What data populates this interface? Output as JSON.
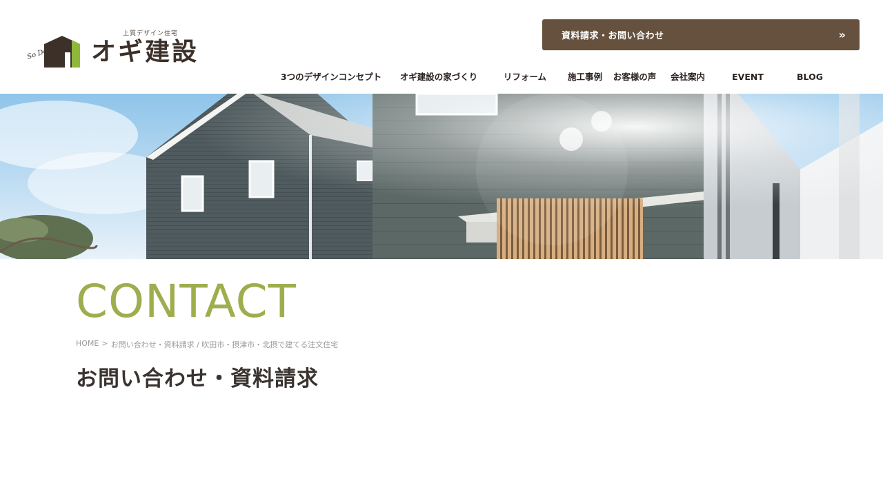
{
  "header": {
    "logo": {
      "tagline": "上質デザイン住宅",
      "name": "オギ建設",
      "script_text": "So Design!",
      "colors": {
        "brand_brown": "#3c3028",
        "brand_green": "#8fb83b"
      }
    },
    "cta": {
      "label": "資料請求・お問い合わせ",
      "icon": "double-chevron-right-icon"
    },
    "nav": [
      {
        "label": "3つのデザインコンセプト"
      },
      {
        "label": "オギ建設の家づくり"
      },
      {
        "label": "リフォーム"
      },
      {
        "label": "施工事例"
      },
      {
        "label": "お客様の声"
      },
      {
        "label": "会社案内"
      },
      {
        "label": "EVENT"
      },
      {
        "label": "BLOG"
      }
    ]
  },
  "main": {
    "heading_en": "CONTACT",
    "breadcrumb": {
      "home": "HOME",
      "separator": ">",
      "current": "お問い合わせ・資料請求 / 吹田市・摂津市・北摂で建てる注文住宅"
    },
    "title": "お問い合わせ・資料請求"
  },
  "colors": {
    "cta_background": "#65513d",
    "accent_green": "#a0ad4e",
    "text_dark": "#3a3330",
    "breadcrumb_gray": "#9b9b9b"
  }
}
